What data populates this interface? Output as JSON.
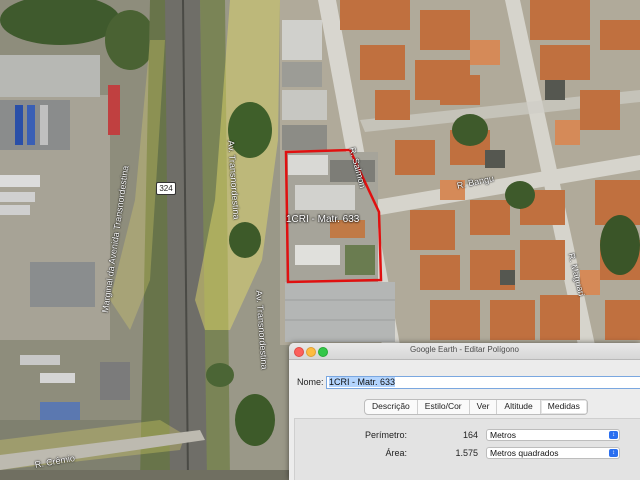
{
  "map": {
    "parcel_label": "1CRI - Matr. 633",
    "route_shield": "324",
    "road_labels": [
      {
        "key": "av1",
        "text": "Av. Transnordestina"
      },
      {
        "key": "av2",
        "text": "Av. Transnordestina"
      },
      {
        "key": "marginal",
        "text": "Marginal da Avenida Transnordestina"
      },
      {
        "key": "salmon",
        "text": "R. Salmon"
      },
      {
        "key": "bangu",
        "text": "R. Bangu"
      },
      {
        "key": "maguari",
        "text": "R. Maguari"
      },
      {
        "key": "cremio",
        "text": "R. Crêmio"
      }
    ],
    "colors": {
      "polygon": "#e01010",
      "highlight": "#e8df6a",
      "ground": "#9a9888"
    }
  },
  "dialog": {
    "title": "Google Earth - Editar Polígono",
    "name_label": "Nome:",
    "name_value": "1CRI - Matr. 633",
    "tabs": [
      "Descrição",
      "Estilo/Cor",
      "Ver",
      "Altitude",
      "Medidas"
    ],
    "active_tab": "Medidas",
    "measures": {
      "perimeter_label": "Perímetro:",
      "perimeter_value": "164",
      "perimeter_unit": "Metros",
      "area_label": "Área:",
      "area_value": "1.575",
      "area_unit": "Metros quadrados"
    }
  }
}
